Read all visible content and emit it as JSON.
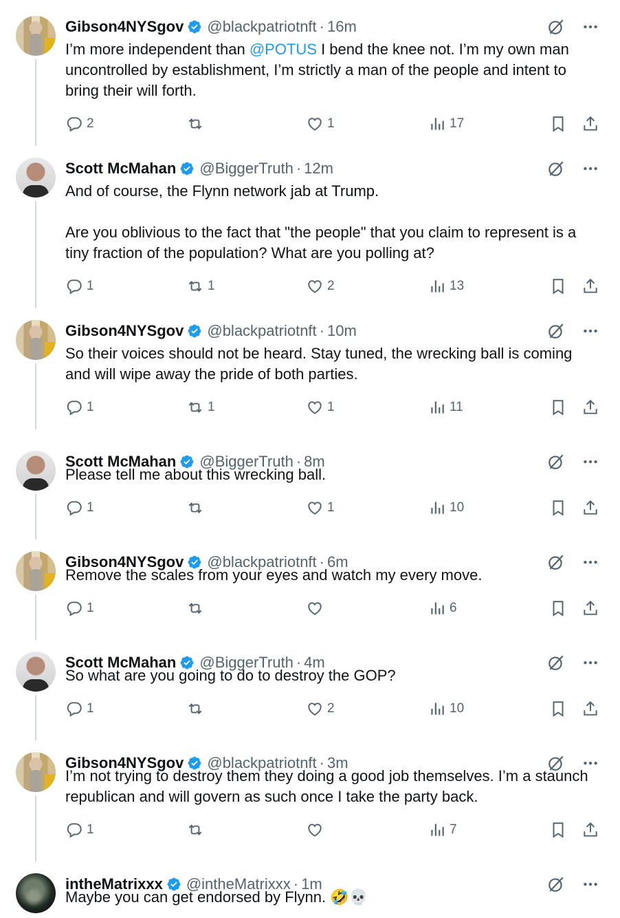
{
  "colors": {
    "text": "#0f1419",
    "secondary": "#536471",
    "link": "#1d9bf0",
    "verified": "#1d9bf0",
    "thread_line": "#cfd9de"
  },
  "tweets": [
    {
      "avatar": "gibson",
      "name": "Gibson4NYSgov",
      "handle": "@blackpatriotnft",
      "dot": "·",
      "time": "16m",
      "text_before": "I’m more independent than ",
      "mention": "@POTUS",
      "text_after": " I bend the knee not. I’m my own man uncontrolled by establishment, I’m strictly a man of the people and intent to bring their will forth.",
      "replies": "2",
      "reposts": "",
      "likes": "1",
      "views": "17"
    },
    {
      "avatar": "scott",
      "name": "Scott McMahan",
      "handle": "@BiggerTruth",
      "dot": "·",
      "time": "12m",
      "paragraphs": [
        "And of course, the Flynn network jab at Trump.",
        "Are you oblivious to the fact that \"the people\" that you claim to represent is a tiny fraction of the population? What are you polling at?"
      ],
      "replies": "1",
      "reposts": "1",
      "likes": "2",
      "views": "13"
    },
    {
      "avatar": "gibson",
      "name": "Gibson4NYSgov",
      "handle": "@blackpatriotnft",
      "dot": "·",
      "time": "10m",
      "text": "So their voices should not be heard. Stay tuned, the wrecking ball is coming and will wipe away the pride of both parties.",
      "replies": "1",
      "reposts": "1",
      "likes": "1",
      "views": "11"
    },
    {
      "avatar": "scott",
      "name": "Scott McMahan",
      "handle": "@BiggerTruth",
      "dot": "·",
      "time": "8m",
      "text": "Please tell me about this wrecking ball.",
      "replies": "1",
      "reposts": "",
      "likes": "1",
      "views": "10"
    },
    {
      "avatar": "gibson",
      "name": "Gibson4NYSgov",
      "handle": "@blackpatriotnft",
      "dot": "·",
      "time": "6m",
      "text": "Remove the scales from your eyes and watch my every move.",
      "replies": "1",
      "reposts": "",
      "likes": "",
      "views": "6"
    },
    {
      "avatar": "scott",
      "name": "Scott McMahan",
      "handle": "@BiggerTruth",
      "dot": "·",
      "time": "4m",
      "text": "So what are you going to do to destroy the GOP?",
      "replies": "1",
      "reposts": "",
      "likes": "2",
      "views": "10"
    },
    {
      "avatar": "gibson",
      "name": "Gibson4NYSgov",
      "handle": "@blackpatriotnft",
      "dot": "·",
      "time": "3m",
      "text": "I’m not trying to destroy them they doing a good job themselves. I’m a staunch republican and will govern as such once I take the party back.",
      "replies": "1",
      "reposts": "",
      "likes": "",
      "views": "7"
    },
    {
      "avatar": "matrix",
      "name": "intheMatrixxx",
      "handle": "@intheMatrixxx",
      "dot": "·",
      "time": "1m",
      "text": "Maybe you can get endorsed by Flynn.",
      "emoji": "🤣💀"
    }
  ],
  "icons": {
    "verified": "verified-badge-icon",
    "grok": "grok-icon",
    "more": "more-options-icon",
    "reply": "reply-icon",
    "repost": "repost-icon",
    "like": "like-icon",
    "views": "views-icon",
    "bookmark": "bookmark-icon",
    "share": "share-icon"
  }
}
